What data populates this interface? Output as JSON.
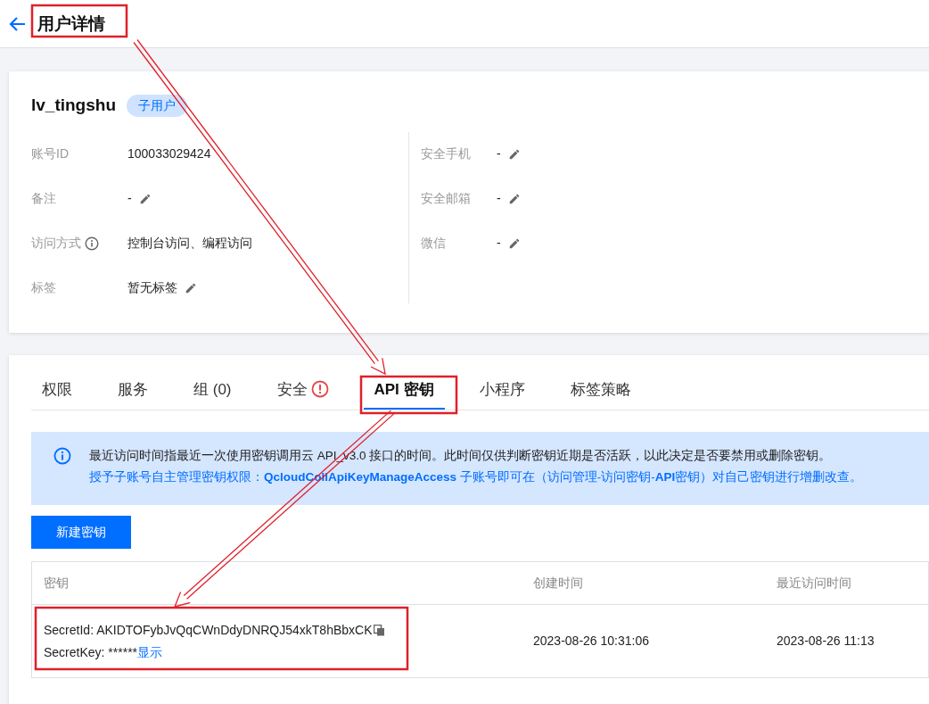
{
  "header": {
    "title": "用户详情"
  },
  "user": {
    "name": "lv_tingshu",
    "badge": "子用户"
  },
  "info_left": [
    {
      "label": "账号ID",
      "value": "100033029424",
      "editable": false,
      "info": false
    },
    {
      "label": "备注",
      "value": "-",
      "editable": true,
      "info": false
    },
    {
      "label": "访问方式",
      "value": "控制台访问、编程访问",
      "editable": false,
      "info": true
    },
    {
      "label": "标签",
      "value": "暂无标签",
      "editable": true,
      "info": false
    }
  ],
  "info_right": [
    {
      "label": "安全手机",
      "value": "-",
      "editable": true
    },
    {
      "label": "安全邮箱",
      "value": "-",
      "editable": true
    },
    {
      "label": "微信",
      "value": "-",
      "editable": true
    }
  ],
  "tabs": [
    {
      "label": "权限",
      "selected": false,
      "alert": false
    },
    {
      "label": "服务",
      "selected": false,
      "alert": false
    },
    {
      "label": "组 (0)",
      "selected": false,
      "alert": false
    },
    {
      "label": "安全",
      "selected": false,
      "alert": true
    },
    {
      "label": "API 密钥",
      "selected": true,
      "alert": false
    },
    {
      "label": "小程序",
      "selected": false,
      "alert": false
    },
    {
      "label": "标签策略",
      "selected": false,
      "alert": false
    }
  ],
  "notice": {
    "line1": "最近访问时间指最近一次使用密钥调用云 API_v3.0 接口的时间。此时间仅供判断密钥近期是否活跃，以此决定是否要禁用或删除密钥。",
    "line2": "授予子账号自主管理密钥权限：**QcloudCollApiKeyManageAccess** 子账号即可在（访问管理-访问密钥-**API**密钥）对自己密钥进行增删改查。"
  },
  "create_button": "新建密钥",
  "table": {
    "columns": [
      "密钥",
      "创建时间",
      "最近访问时间"
    ],
    "rows": [
      {
        "secret_id": "SecretId: AKIDTOFybJvQqCWnDdyDNRQJ54xkT8hBbxCK",
        "secret_key": "SecretKey: ******",
        "show_link": "显示",
        "created": "2023-08-26 10:31:06",
        "last_access": "2023-08-26 11:13"
      }
    ]
  }
}
